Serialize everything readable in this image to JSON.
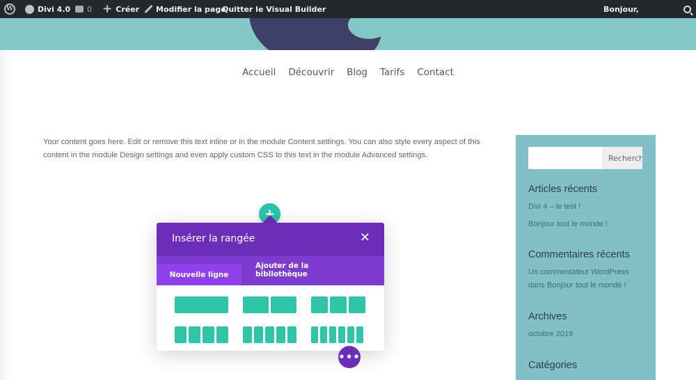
{
  "adminbar": {
    "site_name": "Divi 4.0",
    "comments_count": "0",
    "create_label": "Créer",
    "edit_page_label": "Modifier la page",
    "exit_builder_label": "Quitter le Visual Builder",
    "greeting": "Bonjour,"
  },
  "nav": {
    "items": [
      "Accueil",
      "Découvrir",
      "Blog",
      "Tarifs",
      "Contact"
    ]
  },
  "content": {
    "text": "Your content goes here. Edit or remove this text inline or in the module Content settings. You can also style every aspect of this content in the module Design settings and even apply custom CSS to this text in the module Advanced settings."
  },
  "sidebar": {
    "search_button": "Rechercher",
    "recent_posts_title": "Articles récents",
    "recent_posts": [
      "Divi 4 – le test !",
      "Bonjour tout le monde !"
    ],
    "recent_comments_title": "Commentaires récents",
    "recent_comment_line1": "Un commentateur WordPress",
    "recent_comment_line2": "dans Bonjour tout le monde !",
    "archives_title": "Archives",
    "archive_item": "octobre 2019",
    "categories_title": "Catégories"
  },
  "modal": {
    "title": "Insérer la rangée",
    "close_symbol": "✕",
    "tab_new_row": "Nouvelle ligne",
    "tab_library": "Ajouter de la bibliothèque"
  },
  "builder": {
    "plus_symbol": "+",
    "dots_symbol": "•••"
  },
  "colors": {
    "adminbar_bg": "#23282d",
    "header_teal": "#82c8c5",
    "sidebar_teal": "#82c0c7",
    "modal_purple": "#6c2eb9",
    "tab_purple": "#8f42ec",
    "layout_green": "#2ec6a6"
  },
  "icons": {
    "wordpress": "wordpress-logo-icon",
    "dashboard": "gauge-icon",
    "comments": "comment-bubble-icon",
    "create": "plus-icon",
    "edit": "pencil-icon",
    "search": "search-icon",
    "close": "close-icon"
  }
}
